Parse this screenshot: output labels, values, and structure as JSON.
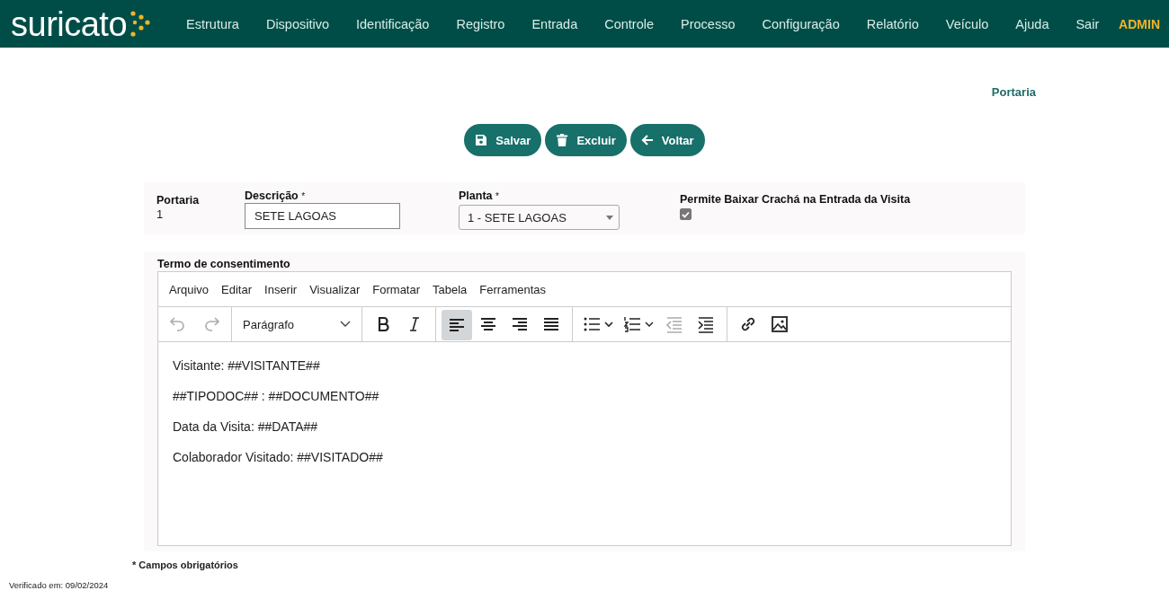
{
  "header": {
    "logo": "suricato",
    "menu": [
      "Estrutura",
      "Dispositivo",
      "Identificação",
      "Registro",
      "Entrada",
      "Controle",
      "Processo",
      "Configuração",
      "Relatório",
      "Veículo",
      "Ajuda",
      "Sair"
    ],
    "user": "ADMIN"
  },
  "page_title": "Portaria",
  "actions": [
    {
      "kind": "save",
      "label": "Salvar"
    },
    {
      "kind": "delete",
      "label": "Excluir"
    },
    {
      "kind": "back",
      "label": "Voltar"
    }
  ],
  "form": {
    "portaria": {
      "label": "Portaria",
      "value": "1"
    },
    "descricao": {
      "label": "Descrição",
      "required_mark": "*",
      "value": "SETE LAGOAS"
    },
    "planta": {
      "label": "Planta",
      "required_mark": "*",
      "value": "1 - SETE LAGOAS"
    },
    "permite": {
      "label": "Permite Baixar Crachá na Entrada da Visita",
      "checked": true
    }
  },
  "editor": {
    "label": "Termo de consentimento",
    "menu": [
      "Arquivo",
      "Editar",
      "Inserir",
      "Visualizar",
      "Formatar",
      "Tabela",
      "Ferramentas"
    ],
    "toolbar": [
      [
        {
          "kind": "undo",
          "disabled": true,
          "selected": false
        },
        {
          "kind": "redo",
          "disabled": true,
          "selected": false
        }
      ],
      [
        {
          "kind": "block",
          "label": "Parágrafo"
        }
      ],
      [
        {
          "kind": "bold",
          "disabled": false,
          "selected": false
        },
        {
          "kind": "italic",
          "disabled": false,
          "selected": false
        }
      ],
      [
        {
          "kind": "align-left",
          "disabled": false,
          "selected": true
        },
        {
          "kind": "align-center",
          "disabled": false,
          "selected": false
        },
        {
          "kind": "align-right",
          "disabled": false,
          "selected": false
        },
        {
          "kind": "justify",
          "disabled": false,
          "selected": false
        }
      ],
      [
        {
          "kind": "bullet-list",
          "disabled": false,
          "selected": false
        },
        {
          "kind": "numbered-list",
          "disabled": false,
          "selected": false
        },
        {
          "kind": "outdent",
          "disabled": true,
          "selected": false
        },
        {
          "kind": "indent",
          "disabled": false,
          "selected": false
        }
      ],
      [
        {
          "kind": "link",
          "disabled": false,
          "selected": false
        },
        {
          "kind": "image",
          "disabled": false,
          "selected": false
        }
      ]
    ],
    "content": [
      "Visitante: ##VISITANTE##",
      "##TIPODOC## : ##DOCUMENTO##",
      "Data da Visita: ##DATA##",
      "Colaborador Visitado: ##VISITADO##"
    ]
  },
  "required_note": "* Campos obrigatórios",
  "verified": "Verificado em: 09/02/2024"
}
